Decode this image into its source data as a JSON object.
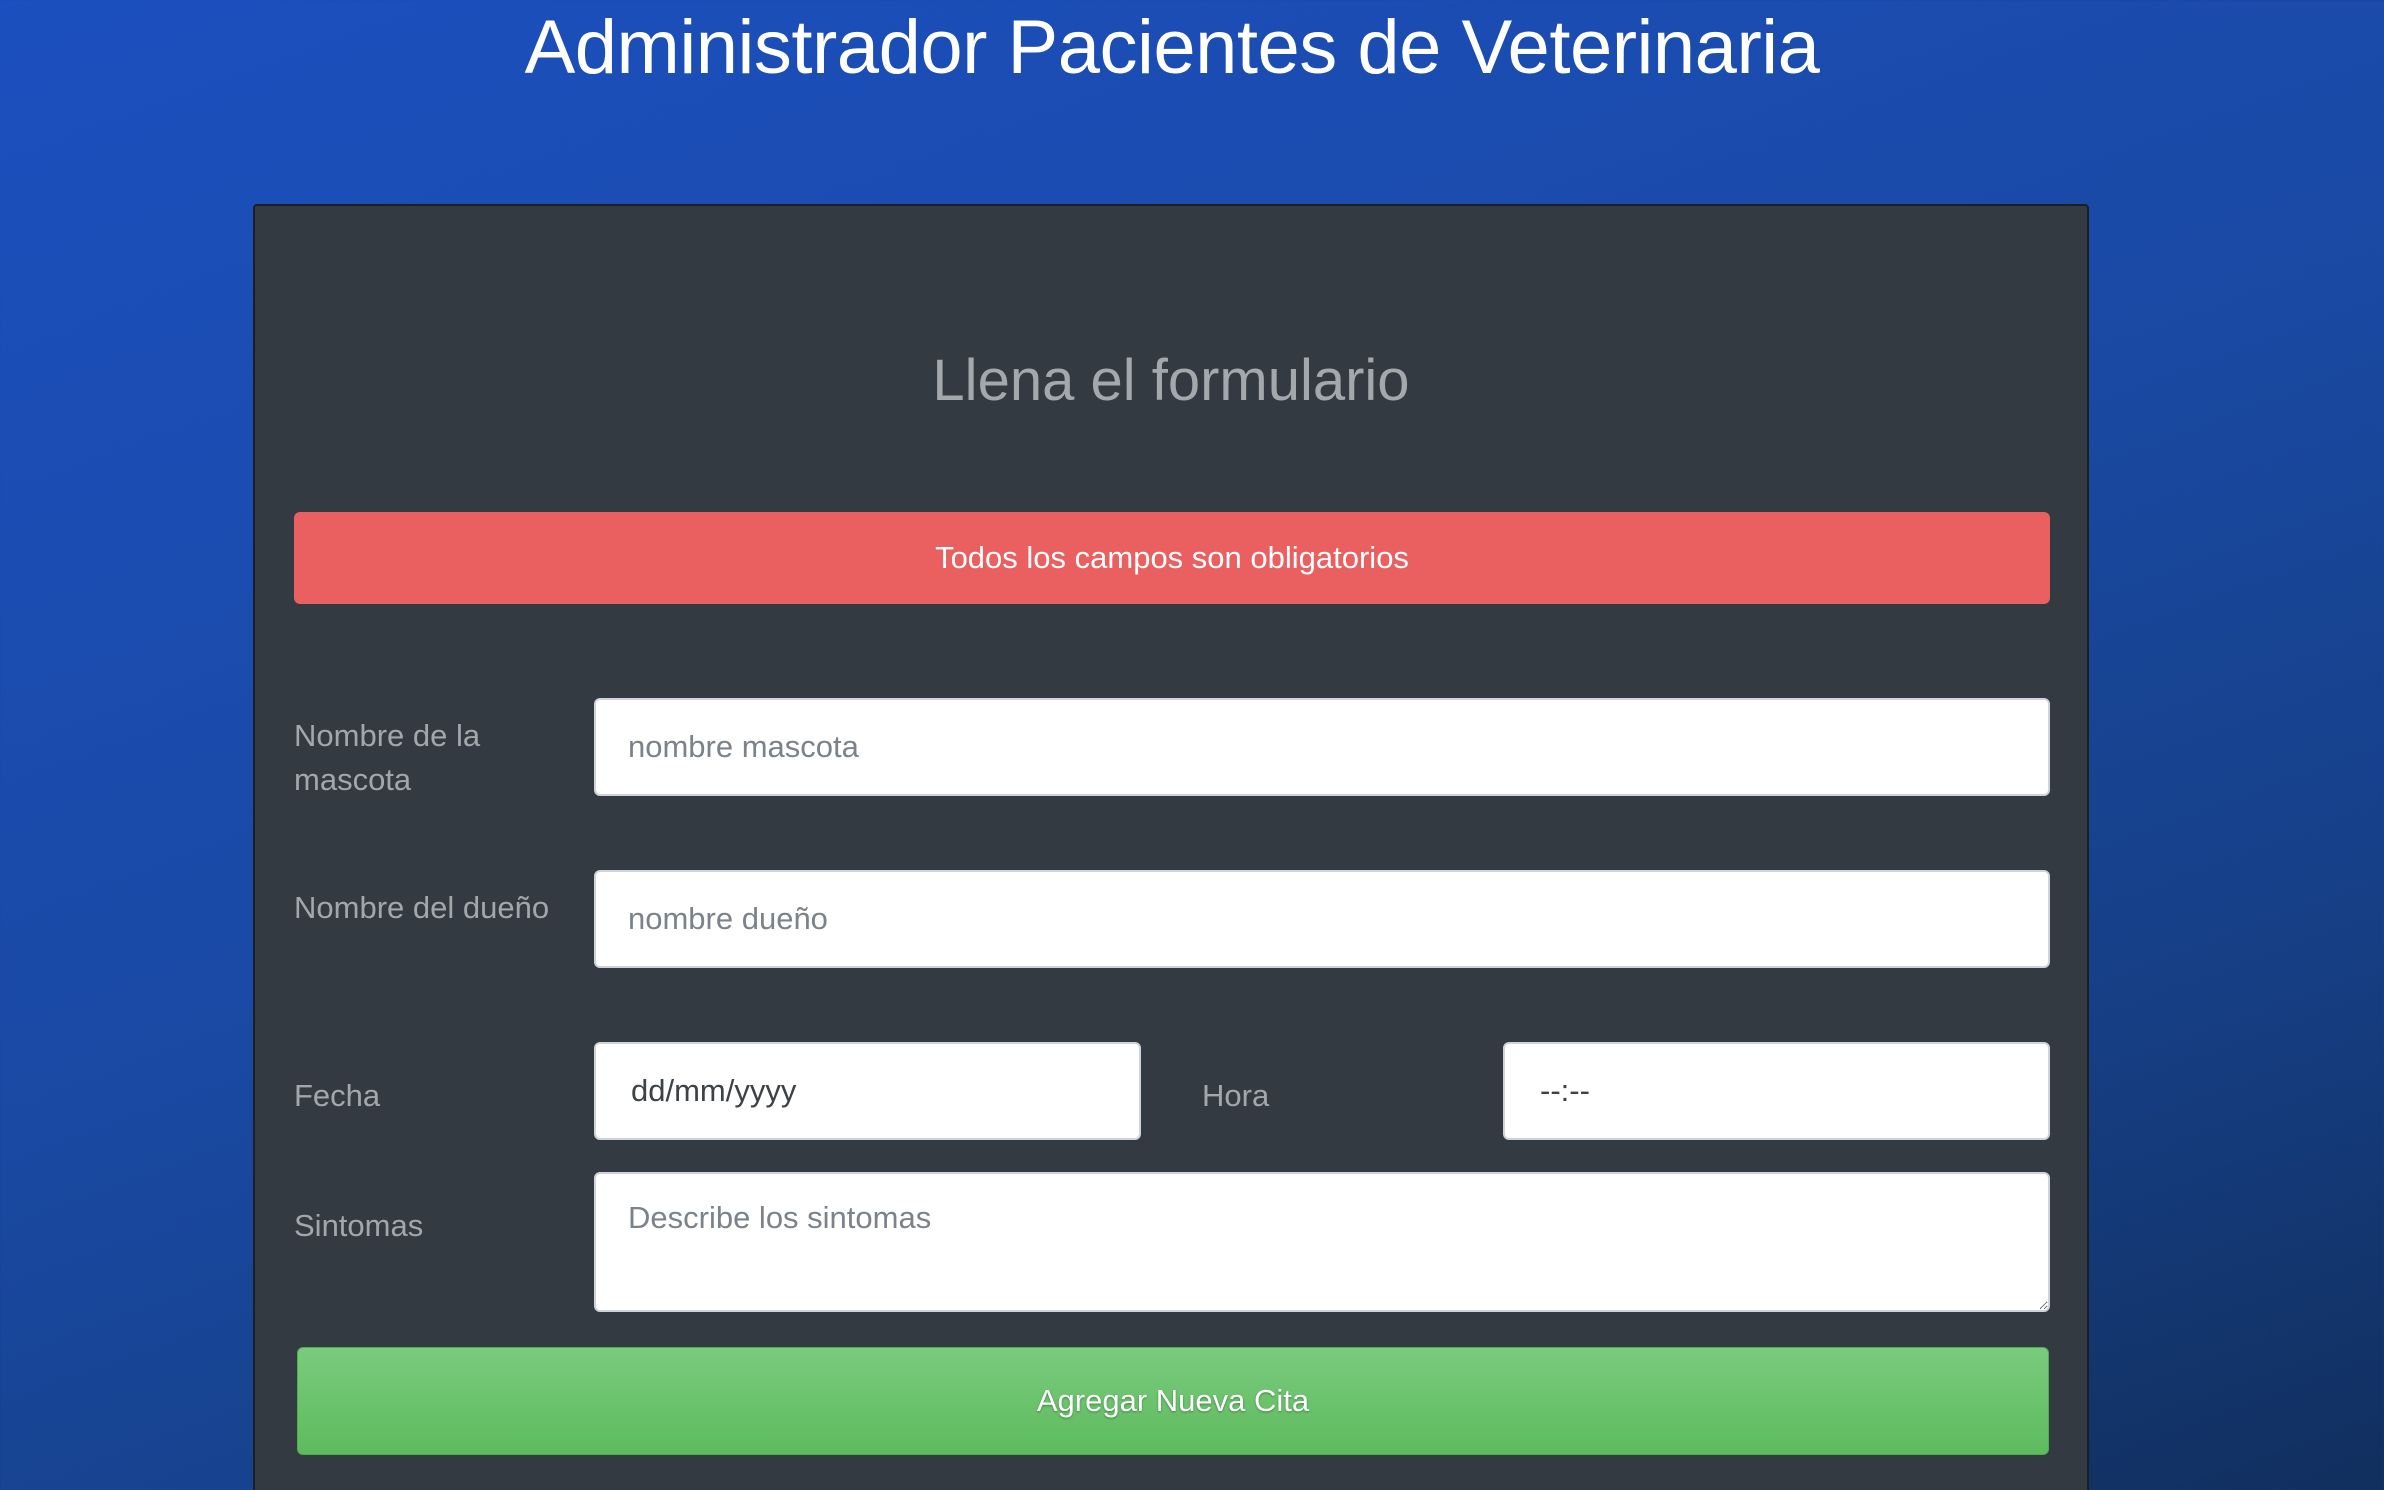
{
  "header": {
    "title": "Administrador Pacientes de Veterinaria"
  },
  "form": {
    "heading": "Llena el formulario",
    "alert": "Todos los campos son obligatorios",
    "pet_name": {
      "label": "Nombre de la mascota",
      "placeholder": "nombre mascota",
      "value": ""
    },
    "owner_name": {
      "label": "Nombre del dueño",
      "placeholder": "nombre dueño",
      "value": ""
    },
    "date": {
      "label": "Fecha",
      "display": "dd/mm/yyyy"
    },
    "time": {
      "label": "Hora",
      "display": "--:--"
    },
    "symptoms": {
      "label": "Sintomas",
      "placeholder": "Describe los sintomas",
      "value": ""
    },
    "submit_label": "Agregar Nueva Cita"
  },
  "colors": {
    "background_start": "#1c4fbf",
    "background_end": "#112f5e",
    "card": "#343a41",
    "alert": "#ea5f5f",
    "submit": "#5dbb5d"
  }
}
